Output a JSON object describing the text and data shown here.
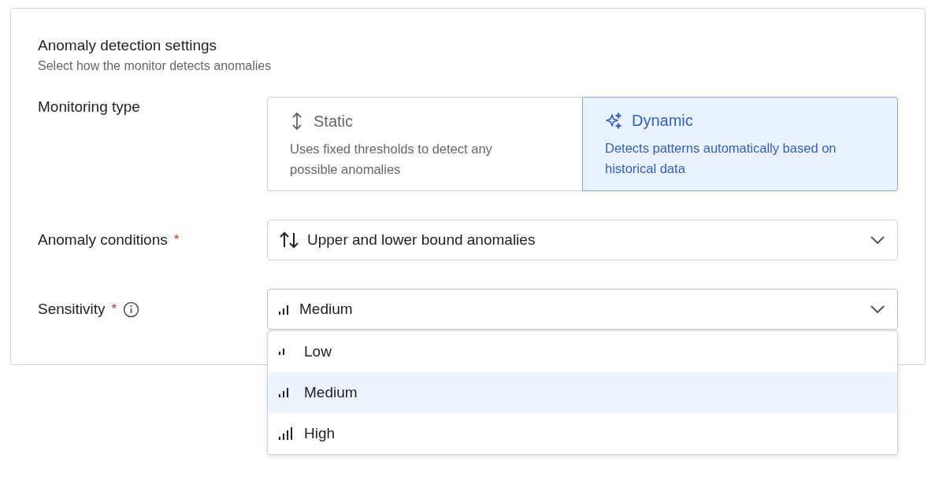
{
  "section": {
    "title": "Anomaly detection settings",
    "subtitle": "Select how the monitor detects anomalies"
  },
  "monitoring_type": {
    "label": "Monitoring type",
    "options": [
      {
        "kind": "static",
        "title": "Static",
        "description": "Uses fixed thresholds to detect any possible anomalies",
        "selected": false
      },
      {
        "kind": "dynamic",
        "title": "Dynamic",
        "description": "Detects patterns automatically based on historical data",
        "selected": true
      }
    ]
  },
  "anomaly_conditions": {
    "label": "Anomaly conditions",
    "required_mark": "*",
    "value": "Upper and lower bound anomalies"
  },
  "sensitivity": {
    "label": "Sensitivity",
    "required_mark": "*",
    "value": "Medium",
    "expanded": true,
    "options": [
      {
        "label": "Low",
        "selected": false
      },
      {
        "label": "Medium",
        "selected": true
      },
      {
        "label": "High",
        "selected": false
      }
    ]
  }
}
